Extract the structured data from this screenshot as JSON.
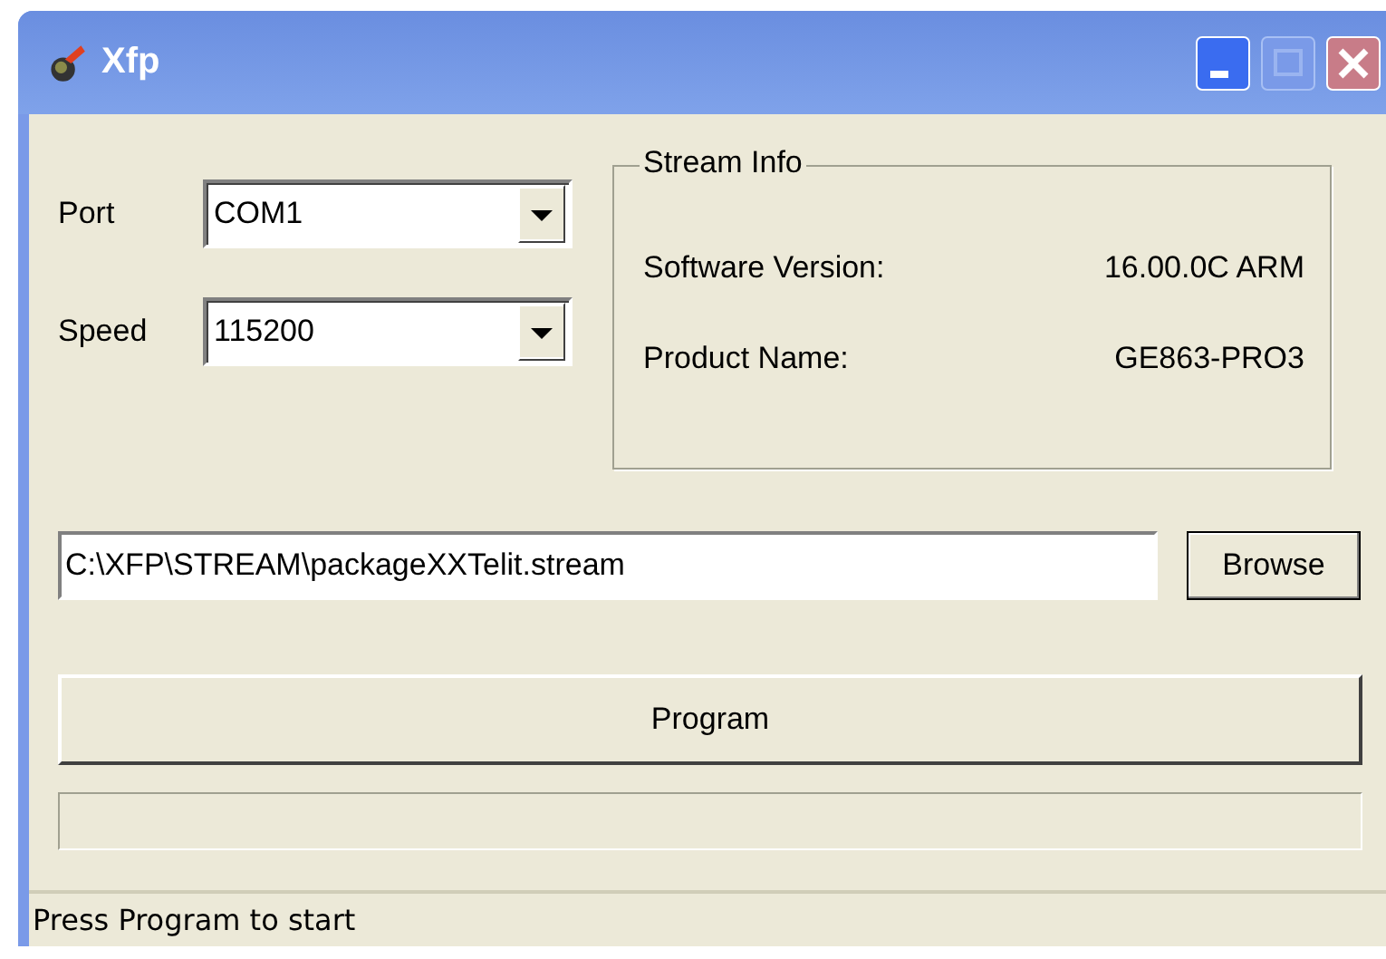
{
  "window": {
    "title": "Xfp"
  },
  "port": {
    "label": "Port",
    "value": "COM1"
  },
  "speed": {
    "label": "Speed",
    "value": "115200"
  },
  "stream_info": {
    "title": "Stream Info",
    "rows": [
      {
        "label": "Software Version:",
        "value": "16.00.0C ARM"
      },
      {
        "label": "Product Name:",
        "value": "GE863-PRO3"
      }
    ]
  },
  "file": {
    "value": "C:\\XFP\\STREAM\\packageXXTelit.stream",
    "browse_button": "Browse"
  },
  "program_button": "Program",
  "progress": {
    "level": 0
  },
  "status_bar": "Press Program to start"
}
